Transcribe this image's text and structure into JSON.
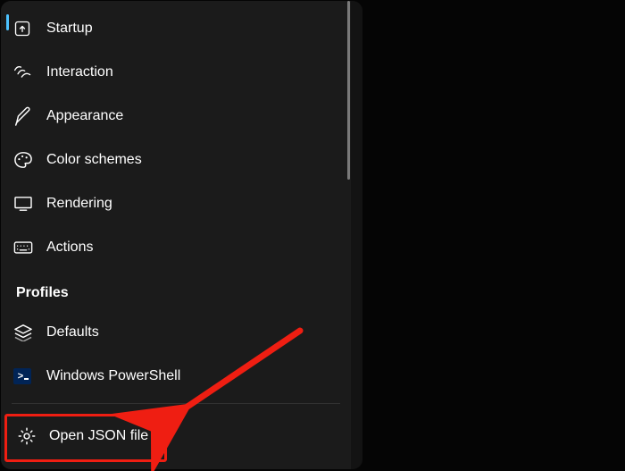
{
  "nav": {
    "items": [
      {
        "label": "Startup",
        "icon": "startup"
      },
      {
        "label": "Interaction",
        "icon": "interaction"
      },
      {
        "label": "Appearance",
        "icon": "appearance"
      },
      {
        "label": "Color schemes",
        "icon": "colorschemes"
      },
      {
        "label": "Rendering",
        "icon": "rendering"
      },
      {
        "label": "Actions",
        "icon": "actions"
      }
    ],
    "section": "Profiles",
    "profiles": [
      {
        "label": "Defaults",
        "icon": "defaults"
      },
      {
        "label": "Windows PowerShell",
        "icon": "powershell"
      }
    ]
  },
  "footer": {
    "label": "Open JSON file",
    "icon": "gear"
  },
  "annotation": {
    "highlight": "Open JSON file"
  }
}
